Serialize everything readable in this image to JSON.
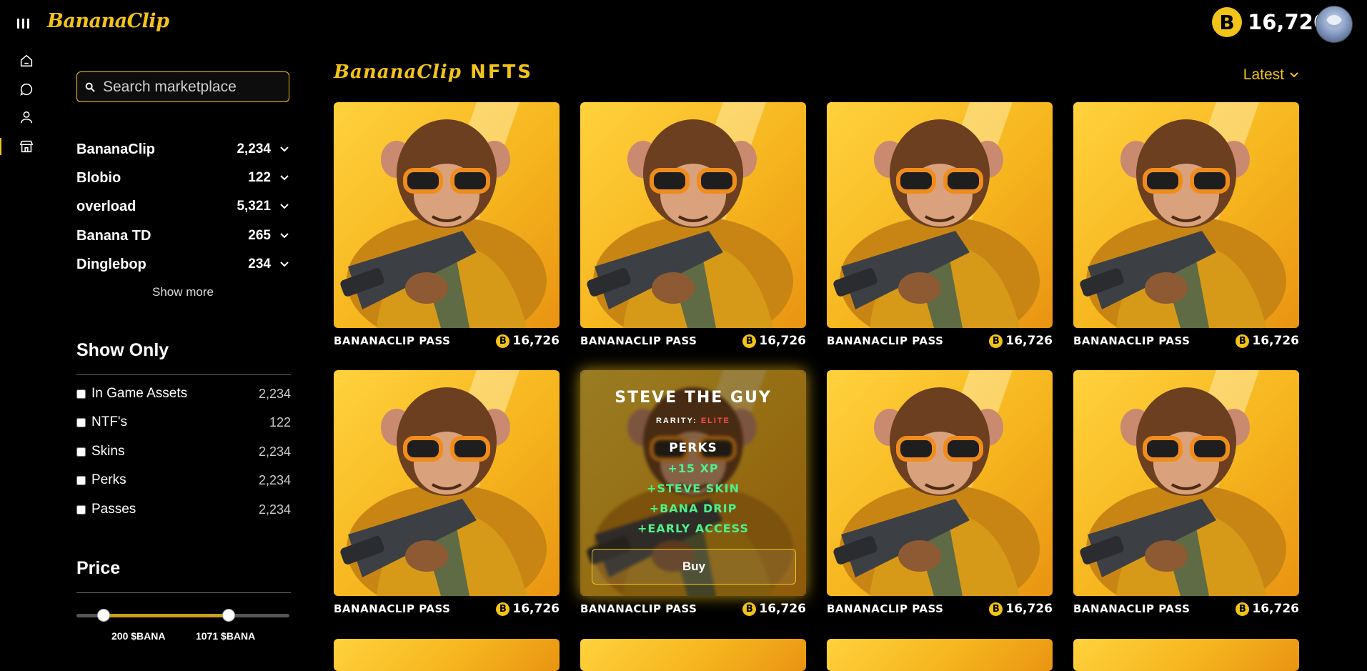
{
  "app": {
    "logo": "BananaClip"
  },
  "header": {
    "balance": "16,726",
    "coin_symbol": "B"
  },
  "search": {
    "placeholder": "Search marketplace"
  },
  "categories": [
    {
      "name": "BananaClip",
      "count": "2,234"
    },
    {
      "name": "Blobio",
      "count": "122"
    },
    {
      "name": "overload",
      "count": "5,321"
    },
    {
      "name": "Banana TD",
      "count": "265"
    },
    {
      "name": "Dinglebop",
      "count": "234"
    }
  ],
  "show_more": "Show more",
  "show_only": {
    "title": "Show Only",
    "items": [
      {
        "label": "In Game Assets",
        "count": "2,234"
      },
      {
        "label": "NTF's",
        "count": "122"
      },
      {
        "label": "Skins",
        "count": "2,234"
      },
      {
        "label": "Perks",
        "count": "2,234"
      },
      {
        "label": "Passes",
        "count": "2,234"
      }
    ]
  },
  "price": {
    "title": "Price",
    "min_label": "200 $BANA",
    "max_label": "1071 $BANA"
  },
  "main": {
    "title_script": "BananaClip",
    "title_suffix": "NFTS",
    "sort": "Latest"
  },
  "cards": [
    {
      "name": "BANANACLIP PASS",
      "price": "16,726"
    },
    {
      "name": "BANANACLIP PASS",
      "price": "16,726"
    },
    {
      "name": "BANANACLIP PASS",
      "price": "16,726"
    },
    {
      "name": "BANANACLIP PASS",
      "price": "16,726"
    },
    {
      "name": "BANANACLIP PASS",
      "price": "16,726"
    },
    {
      "name": "BANANACLIP PASS",
      "price": "16,726"
    },
    {
      "name": "BANANACLIP PASS",
      "price": "16,726"
    },
    {
      "name": "BANANACLIP PASS",
      "price": "16,726"
    }
  ],
  "hover": {
    "title": "STEVE THE GUY",
    "rarity_label": "RARITY:",
    "rarity_value": "ELITE",
    "perks_title": "PERKS",
    "perks": [
      "+15 XP",
      "+STEVE SKIN",
      "+BANA DRIP",
      "+EARLY ACCESS"
    ],
    "buy": "Buy"
  },
  "colors": {
    "accent": "#f2c318",
    "perk": "#4df08a",
    "rarity": "#ff4d4d"
  }
}
